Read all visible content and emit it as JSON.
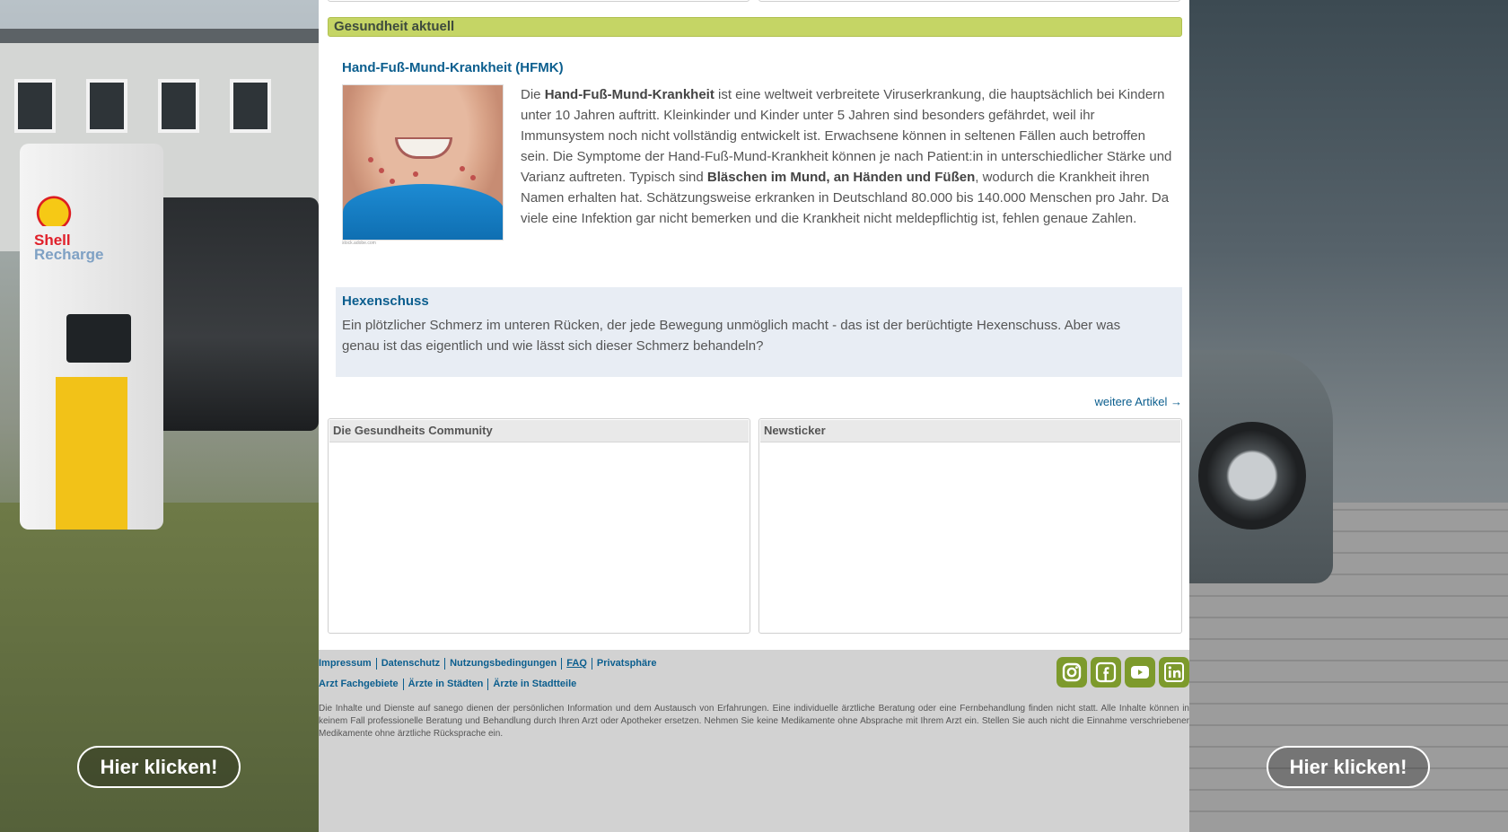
{
  "ad": {
    "button_label_left": "Hier klicken!",
    "button_label_right": "Hier klicken!",
    "brand_line1": "Shell",
    "brand_line2": "Recharge"
  },
  "section": {
    "title": "Gesundheit aktuell"
  },
  "article": {
    "title": "Hand-Fuß-Mund-Krankheit (HFMK)",
    "image_credit": "stock.adobe.com",
    "text_1": "Die ",
    "bold_1": "Hand-Fuß-Mund-Krankheit",
    "text_2": " ist eine weltweit verbreitete Viruserkrankung, die hauptsächlich bei Kindern unter 10 Jahren auftritt. Kleinkinder und Kinder unter 5 Jahren sind besonders gefährdet, weil ihr Immunsystem noch nicht vollständig entwickelt ist. Erwachsene können in seltenen Fällen auch betroffen sein. Die Symptome der Hand-Fuß-Mund-Krankheit können je nach Patient:in in unterschiedlicher Stärke und Varianz auftreten. Typisch sind ",
    "bold_2": "Bläschen im Mund, an Händen und Füßen",
    "text_3": ", wodurch die Krankheit ihren Namen erhalten hat. Schätzungsweise erkranken in Deutschland 80.000 bis 140.000 Menschen pro Jahr. Da viele eine Infektion gar nicht bemerken und die Krankheit nicht meldepflichtig ist, fehlen genaue Zahlen."
  },
  "teaser": {
    "title": "Hexenschuss",
    "text": "Ein plötzlicher Schmerz im unteren Rücken, der jede Bewegung unmöglich macht - das ist der berüchtigte Hexenschuss. Aber was genau ist das eigentlich und wie lässt sich dieser Schmerz behandeln?"
  },
  "more_link": "weitere Artikel →",
  "boxes": {
    "community": "Die Gesundheits Community",
    "newsticker": "Newsticker"
  },
  "footer": {
    "links_row1": [
      "Impressum",
      "Datenschutz",
      "Nutzungsbedingungen",
      "FAQ",
      "Privatsphäre"
    ],
    "links_row2": [
      "Arzt Fachgebiete",
      "Ärzte in Städten",
      "Ärzte in Stadtteile"
    ],
    "disclaimer": "Die Inhalte und Dienste auf sanego dienen der persönlichen Information und dem Austausch von Erfahrungen. Eine individuelle ärztliche Beratung oder eine Fernbehandlung finden nicht statt. Alle Inhalte können in keinem Fall professionelle Beratung und Behandlung durch Ihren Arzt oder Apotheker ersetzen. Nehmen Sie keine Medikamente ohne Absprache mit Ihrem Arzt ein. Stellen Sie auch nicht die Einnahme verschriebener Medikamente ohne ärztliche Rücksprache ein.",
    "social_icons": [
      "instagram-icon",
      "facebook-icon",
      "youtube-icon",
      "linkedin-icon"
    ],
    "accent_color": "#7d9a2c"
  },
  "colors": {
    "section_bar": "#c5d565",
    "link": "#0b5e8e",
    "teaser_bg": "#e8edf4"
  }
}
